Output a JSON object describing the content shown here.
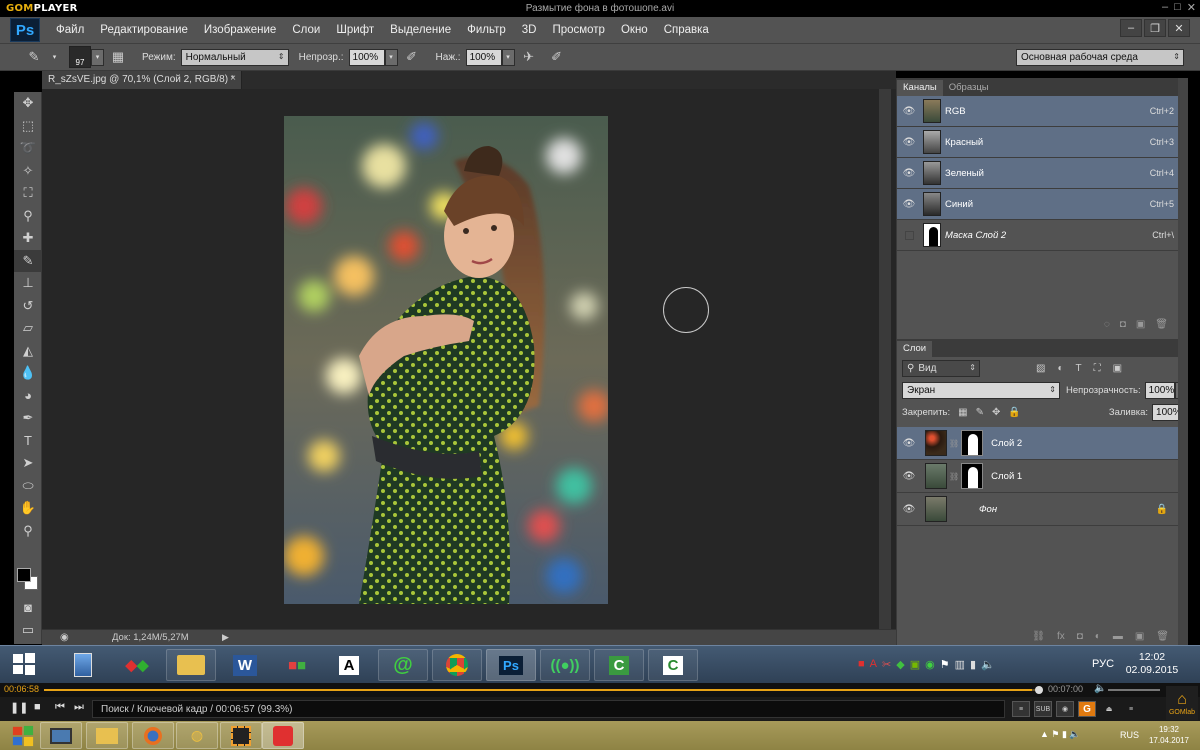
{
  "player": {
    "logo_prefix": "GOM",
    "logo_suffix": "PLAYER",
    "file_title": "Размытие фона в фотошопе.avi",
    "current_time": "00:06:58",
    "total_time": "00:07:00",
    "progress_fraction": 0.993,
    "status_text": "Поиск / Ключевой кадр / 00:06:57 (99.3%)",
    "right_icons": [
      "≡",
      "SUB",
      "◉",
      "G"
    ],
    "lab_label": "GOMlab"
  },
  "photoshop": {
    "logo": "Ps",
    "menu": [
      "Файл",
      "Редактирование",
      "Изображение",
      "Слои",
      "Шрифт",
      "Выделение",
      "Фильтр",
      "3D",
      "Просмотр",
      "Окно",
      "Справка"
    ],
    "options": {
      "brush_size": "97",
      "mode_label": "Режим:",
      "mode_value": "Нормальный",
      "opacity_label": "Непрозр.:",
      "opacity_value": "100%",
      "flow_label": "Наж.:",
      "flow_value": "100%",
      "workspace": "Основная рабочая среда"
    },
    "document_tab": "R_sZsVE.jpg @ 70,1% (Слой 2, RGB/8) *",
    "status_doc": "Док: 1,24M/5,27M",
    "channels_panel": {
      "tabs": [
        "Каналы",
        "Образцы"
      ],
      "channels": [
        {
          "name": "RGB",
          "shortcut": "Ctrl+2",
          "selected": true
        },
        {
          "name": "Красный",
          "shortcut": "Ctrl+3",
          "selected": true
        },
        {
          "name": "Зеленый",
          "shortcut": "Ctrl+4",
          "selected": true
        },
        {
          "name": "Синий",
          "shortcut": "Ctrl+5",
          "selected": true
        },
        {
          "name": "Маска Слой 2",
          "shortcut": "Ctrl+\\",
          "selected": false
        }
      ]
    },
    "layers_panel": {
      "tab": "Слои",
      "filter_kind": "Вид",
      "blend_mode": "Экран",
      "opacity_label": "Непрозрачность:",
      "opacity_value": "100%",
      "lock_label": "Закрепить:",
      "fill_label": "Заливка:",
      "fill_value": "100%",
      "layers": [
        {
          "name": "Слой 2",
          "selected": true,
          "has_mask": true,
          "locked": false
        },
        {
          "name": "Слой 1",
          "selected": false,
          "has_mask": true,
          "locked": false
        },
        {
          "name": "Фон",
          "selected": false,
          "has_mask": false,
          "locked": true
        }
      ]
    }
  },
  "video_taskbar": {
    "language": "РУС",
    "time": "12:02",
    "date": "02.09.2015",
    "apps": [
      "calculator",
      "browser",
      "folder",
      "W",
      "office",
      "A",
      "@",
      "chrome",
      "Ps",
      "signal",
      "camtasia",
      "camtasia-2"
    ]
  },
  "desktop_taskbar": {
    "language": "RUS",
    "time": "19:32",
    "date": "17.04.2017"
  },
  "colors": {
    "ps_panel": "#535353",
    "selection": "#5f6f86",
    "gom_accent": "#e8a316"
  }
}
